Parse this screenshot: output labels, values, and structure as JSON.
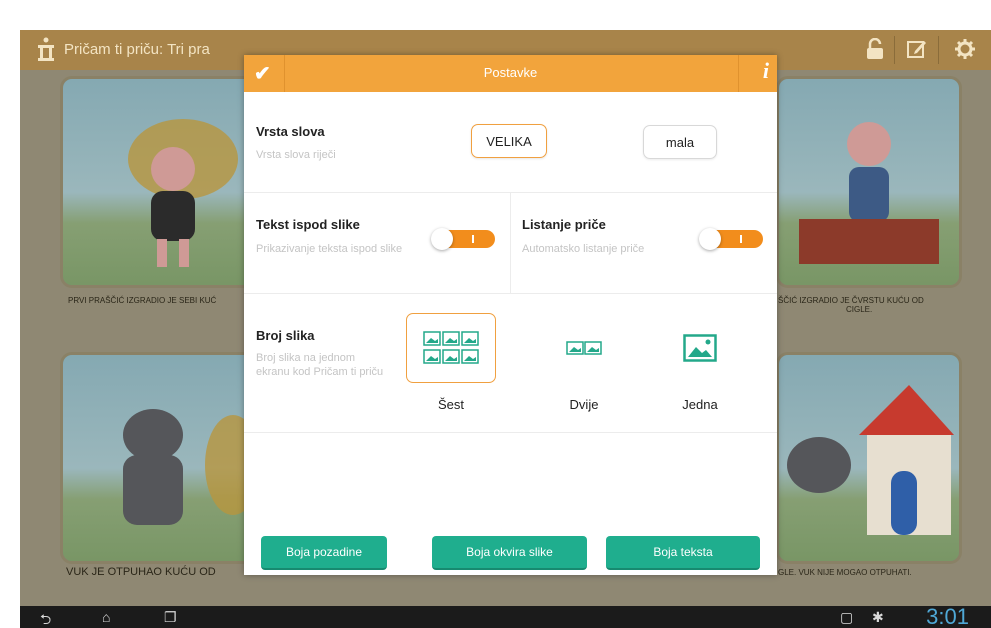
{
  "app": {
    "title": "Pričam ti priču: Tri pra",
    "icons": [
      "storybook-icon",
      "lock-icon",
      "edit-icon",
      "settings-icon"
    ],
    "captions": {
      "top_left": "PRVI PRAŠČIĆ IZGRADIO JE SEBI KUĆ",
      "top_right_1": "ŠČIĆ IZGRADIO JE ČVRSTU KUĆU OD",
      "top_right_2": "CIGLE.",
      "bottom_left": "VUK JE OTPUHAO KUĆU OD",
      "bottom_right": "GLE. VUK NIJE MOGAO OTPUHATI."
    },
    "clock": "3:01"
  },
  "dialog": {
    "title": "Postavke",
    "info_label": "i",
    "font_type": {
      "label": "Vrsta slova",
      "description": "Vrsta slova riječi",
      "options": [
        "VELIKA",
        "mala"
      ],
      "selected": "VELIKA"
    },
    "text_below": {
      "label": "Tekst ispod slike",
      "description": "Prikazivanje teksta ispod slike",
      "enabled": true
    },
    "story_paging": {
      "label": "Listanje priče",
      "description": "Automatsko listanje priče",
      "enabled": true
    },
    "image_count": {
      "label": "Broj slika",
      "description": "Broj slika na jednom ekranu kod Pričam ti priču",
      "options": [
        "Šest",
        "Dvije",
        "Jedna"
      ],
      "selected": "Šest"
    },
    "buttons": [
      "Boja pozadine",
      "Boja okvira slike",
      "Boja teksta"
    ]
  },
  "colors": {
    "accent_orange": "#f2a43c",
    "toggle_orange": "#f28d1c",
    "button_green": "#1fae8e",
    "topbar_brown": "#a8844a",
    "icon_teal": "#23a88a"
  }
}
